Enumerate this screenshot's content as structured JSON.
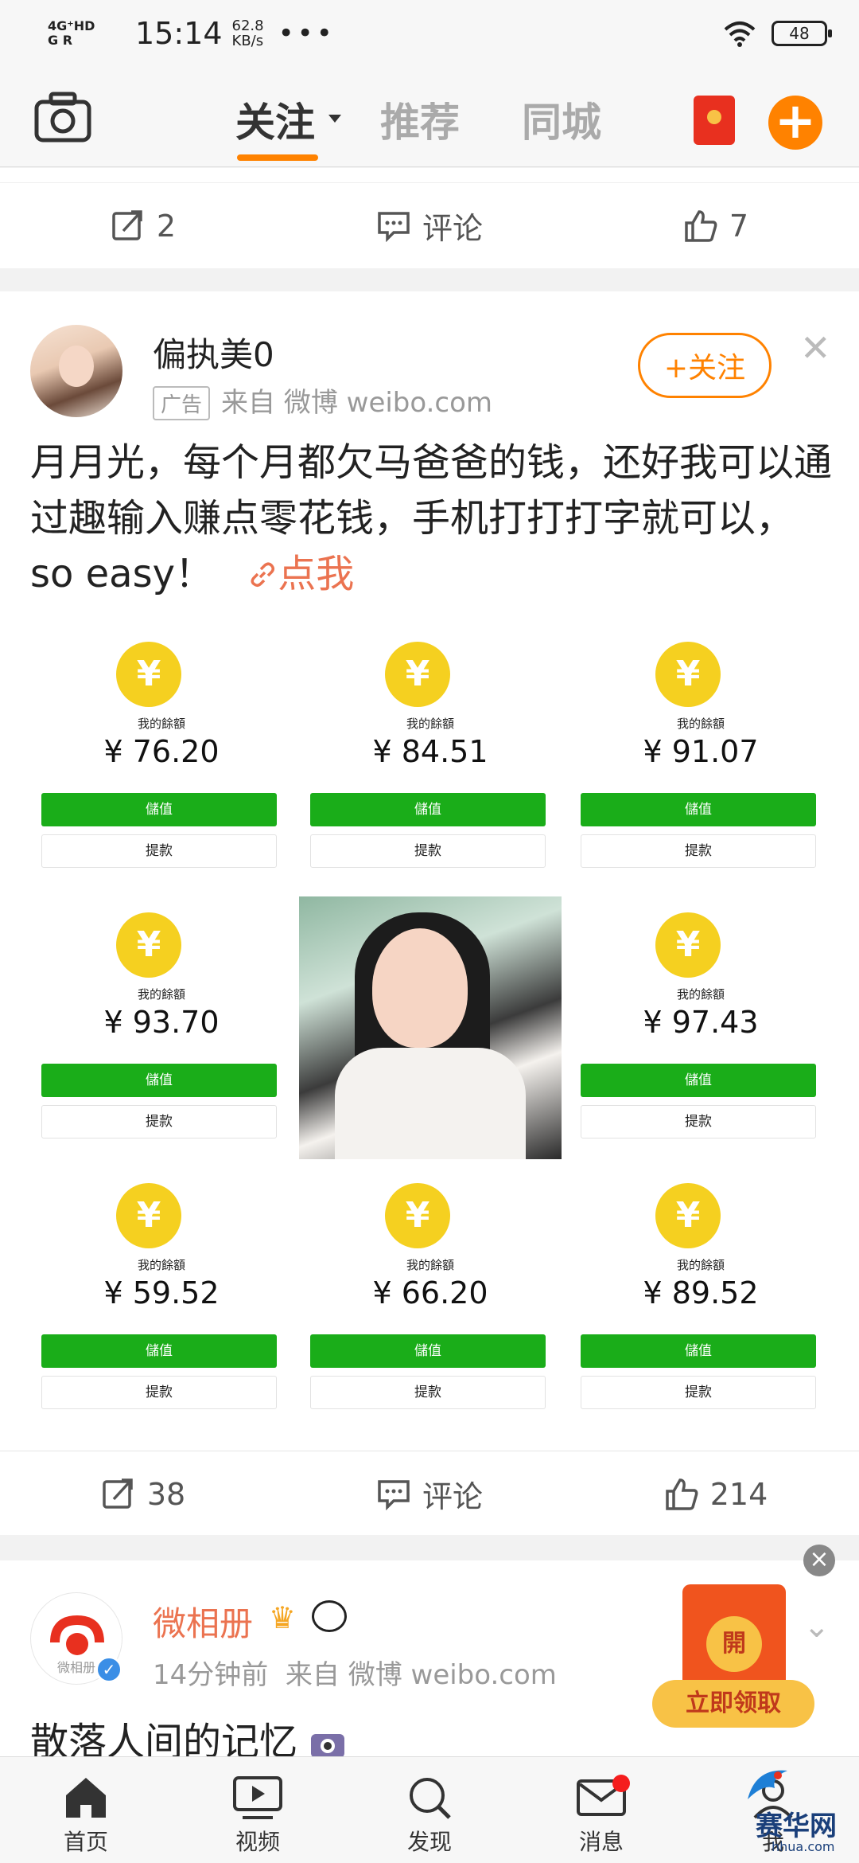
{
  "status_bar": {
    "network": "4G⁺HD G R",
    "time": "15:14",
    "speed_value": "62.8",
    "speed_unit": "KB/s",
    "dots": "•••",
    "battery": "48"
  },
  "top_nav": {
    "tabs": [
      {
        "label": "关注",
        "active": true
      },
      {
        "label": "推荐",
        "active": false
      },
      {
        "label": "同城",
        "active": false
      }
    ],
    "accent": "#ff8200"
  },
  "prev_post": {
    "repost_count": "2",
    "comment_label": "评论",
    "like_count": "7"
  },
  "ad_post": {
    "username": "偏执美0",
    "ad_tag": "广告",
    "source": "来自 微博 weibo.com",
    "follow_label": "+关注",
    "text_main": "月月光，每个月都欠马爸爸的钱，还好我可以通过趣输入赚点零花钱，手机打打打字就可以，so easy！",
    "link_text": "点我",
    "coin_label": "我的餘額",
    "recharge_label": "儲值",
    "withdraw_label": "提款",
    "balances": [
      "¥ 76.20",
      "¥ 84.51",
      "¥ 91.07",
      "¥ 93.70",
      "¥ 97.43",
      "¥ 59.52",
      "¥ 66.20",
      "¥ 89.52"
    ],
    "repost_count": "38",
    "comment_label": "评论",
    "like_count": "214"
  },
  "next_post": {
    "username": "微相册",
    "avatar_label": "微相册",
    "time": "14分钟前",
    "source": "来自 微博 weibo.com",
    "text": "散落人间的记忆"
  },
  "float_ad": {
    "envelope_char": "開",
    "button": "立即领取",
    "close": "×"
  },
  "bottom_nav": {
    "items": [
      {
        "label": "首页",
        "icon": "home-icon"
      },
      {
        "label": "视频",
        "icon": "video-icon"
      },
      {
        "label": "发现",
        "icon": "search-icon"
      },
      {
        "label": "消息",
        "icon": "message-icon"
      },
      {
        "label": "我",
        "icon": "profile-icon"
      }
    ]
  },
  "watermark": "赛华网",
  "watermark_url": "hhua.com"
}
